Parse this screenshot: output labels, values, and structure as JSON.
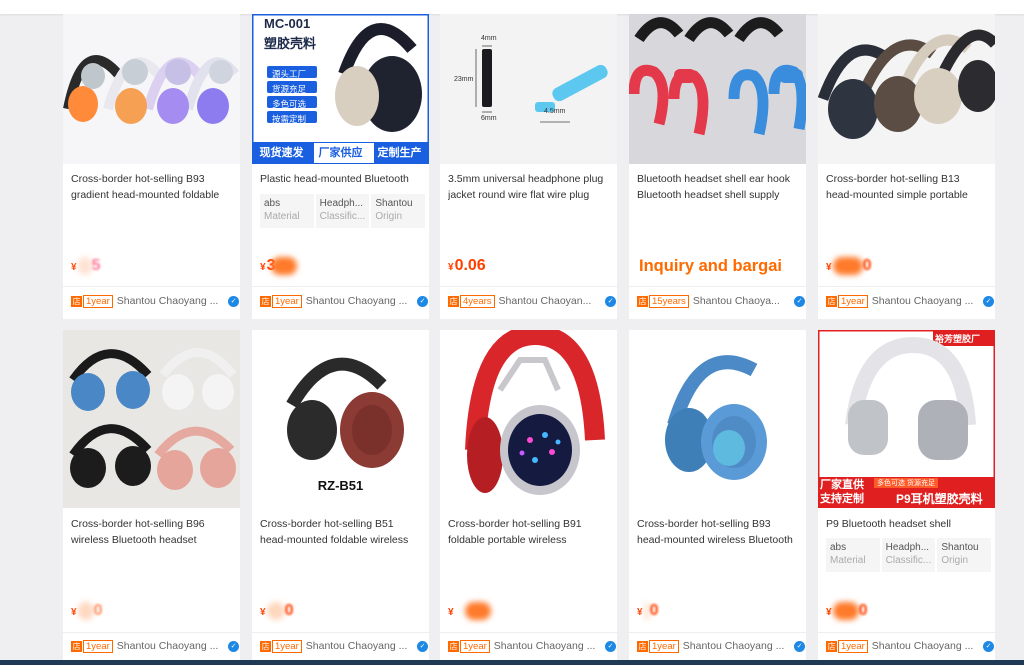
{
  "currency": "¥",
  "products": [
    {
      "title": "Cross-border hot-selling B93 gradient head-mounted foldable",
      "price": "5",
      "price_obscured": true,
      "years": "1year",
      "seller": "Shantou Chaoyang ..."
    },
    {
      "title": "Plastic head-mounted Bluetooth",
      "price": "3",
      "price_obscured": true,
      "years": "1year",
      "seller": "Shantou Chaoyang ...",
      "attributes": [
        {
          "value": "abs",
          "key": "Material"
        },
        {
          "value": "Headph...",
          "key": "Classific..."
        },
        {
          "value": "Shantou",
          "key": "Origin"
        }
      ],
      "banner": {
        "model": "MC-001",
        "subtitle": "塑胶壳料",
        "tags": [
          "源头工厂",
          "货源充足",
          "多色可选",
          "按需定制"
        ],
        "strip": [
          "现货速发",
          "厂家供应",
          "定制生产"
        ]
      }
    },
    {
      "title": "3.5mm universal headphone plug jacket round wire flat wire plug",
      "price": "0.06",
      "price_obscured": false,
      "years": "4years",
      "seller": "Shantou Chaoyan...",
      "dimensions": [
        "4mm",
        "23mm",
        "6mm",
        "4.5mm"
      ]
    },
    {
      "title": "Bluetooth headset shell ear hook Bluetooth headset shell supply",
      "price_text": "Inquiry and bargai",
      "years": "15years",
      "seller": "Shantou Chaoya..."
    },
    {
      "title": "Cross-border hot-selling B13 head-mounted simple portable",
      "price": "0",
      "price_obscured": true,
      "years": "1year",
      "seller": "Shantou Chaoyang ..."
    },
    {
      "title": "Cross-border hot-selling B96 wireless Bluetooth headset",
      "price": "0",
      "price_obscured": true,
      "years": "1year",
      "seller": "Shantou Chaoyang ..."
    },
    {
      "title": "Cross-border hot-selling B51 head-mounted foldable wireless",
      "price": "0",
      "price_obscured": true,
      "years": "1year",
      "seller": "Shantou Chaoyang ...",
      "image_label": "RZ-B51"
    },
    {
      "title": "Cross-border hot-selling B91 foldable portable wireless",
      "price": "",
      "price_obscured": true,
      "years": "1year",
      "seller": "Shantou Chaoyang ..."
    },
    {
      "title": "Cross-border hot-selling B93 head-mounted wireless Bluetooth",
      "price": "0",
      "price_obscured": true,
      "years": "1year",
      "seller": "Shantou Chaoyang ..."
    },
    {
      "title": "P9 Bluetooth headset shell",
      "price": "0",
      "price_obscured": true,
      "years": "1year",
      "seller": "Shantou Chaoyang ...",
      "attributes": [
        {
          "value": "abs",
          "key": "Material"
        },
        {
          "value": "Headph...",
          "key": "Classific..."
        },
        {
          "value": "Shantou",
          "key": "Origin"
        }
      ],
      "banner": {
        "corner": "裕芳塑胶厂",
        "left": [
          "厂家直供",
          "支持定制"
        ],
        "tags": [
          "多色可选",
          "货源充足"
        ],
        "right": "P9耳机塑胶壳料"
      }
    }
  ],
  "colors": {
    "price": "#ff4000",
    "accent": "#ff6a00",
    "underline": "#d41010",
    "verified": "#1e88e5"
  }
}
